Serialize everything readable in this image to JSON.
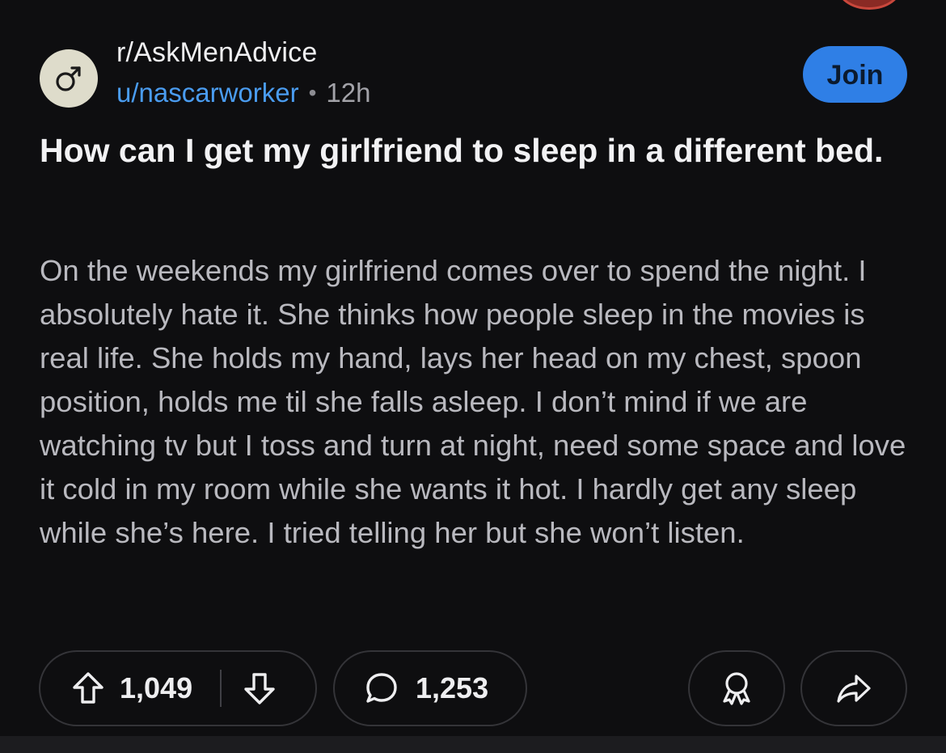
{
  "post": {
    "subreddit": "r/AskMenAdvice",
    "author": "u/nascarworker",
    "separator": "•",
    "age": "12h",
    "join_label": "Join",
    "title": "How can I get my girlfriend to sleep in a different bed.",
    "body": "On the weekends my girlfriend comes over to spend the night. I absolutely hate it. She thinks how people sleep in the movies is real life. She holds my hand, lays her head on my chest, spoon position, holds me til she falls asleep. I don’t mind if we are watching tv but I toss and turn at night, need some space and love it cold in my room while she wants it hot. I hardly get any sleep while she’s here. I tried telling her but she won’t listen."
  },
  "actions": {
    "upvote_count": "1,049",
    "comment_count": "1,253",
    "icons": {
      "subreddit_avatar": "male-symbol-icon",
      "upvote": "arrow-up-icon",
      "downvote": "arrow-down-icon",
      "comment": "speech-bubble-icon",
      "award": "award-ribbon-icon",
      "share": "share-arrow-icon"
    }
  },
  "colors": {
    "background": "#0e0e10",
    "accent": "#2f7fe6",
    "author_link": "#4a9cf0",
    "body_text": "#b9b9bf",
    "pill_border": "#343438"
  }
}
